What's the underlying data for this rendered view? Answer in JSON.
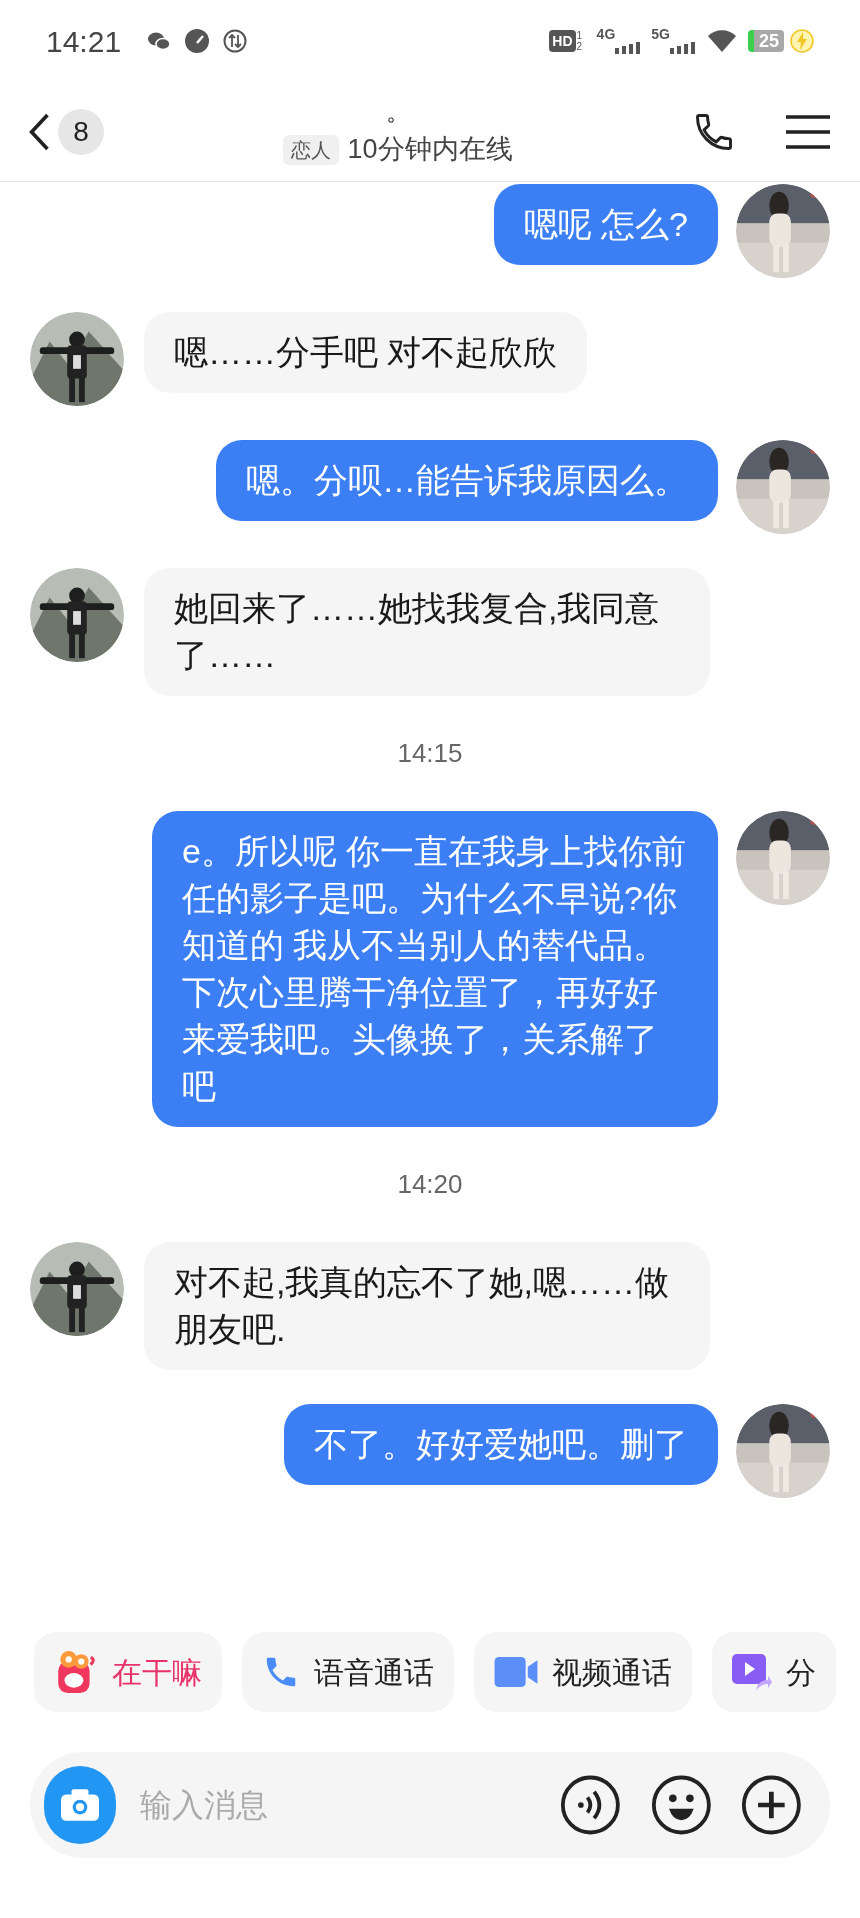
{
  "status_bar": {
    "time": "14:21",
    "hd": "HD",
    "hd_sims": "1 2",
    "net_1": "4G",
    "net_2": "5G",
    "battery": "25"
  },
  "header": {
    "unread_count": "8",
    "title": "。",
    "tag": "恋人",
    "presence": "10分钟内在线"
  },
  "messages": [
    {
      "kind": "sent",
      "text": "嗯呢 怎么?"
    },
    {
      "kind": "received",
      "text": "嗯……分手吧 对不起欣欣"
    },
    {
      "kind": "sent",
      "text": "嗯。分呗…能告诉我原因么。"
    },
    {
      "kind": "received",
      "text": "她回来了……她找我复合,我同意了……"
    },
    {
      "kind": "time",
      "text": "14:15"
    },
    {
      "kind": "sent",
      "text": "e。所以呢 你一直在我身上找你前任的影子是吧。为什么不早说?你知道的 我从不当别人的替代品。下次心里腾干净位置了，再好好来爱我吧。头像换了，关系解了吧"
    },
    {
      "kind": "time",
      "text": "14:20"
    },
    {
      "kind": "received",
      "text": "对不起,我真的忘不了她,嗯……做朋友吧."
    },
    {
      "kind": "sent",
      "text": "不了。好好爱她吧。删了"
    }
  ],
  "quick_actions": [
    {
      "kind": "greet",
      "label": "在干嘛"
    },
    {
      "kind": "voice",
      "label": "语音通话"
    },
    {
      "kind": "video",
      "label": "视频通话"
    },
    {
      "kind": "share",
      "label": "分"
    }
  ],
  "composer": {
    "placeholder": "输入消息"
  }
}
